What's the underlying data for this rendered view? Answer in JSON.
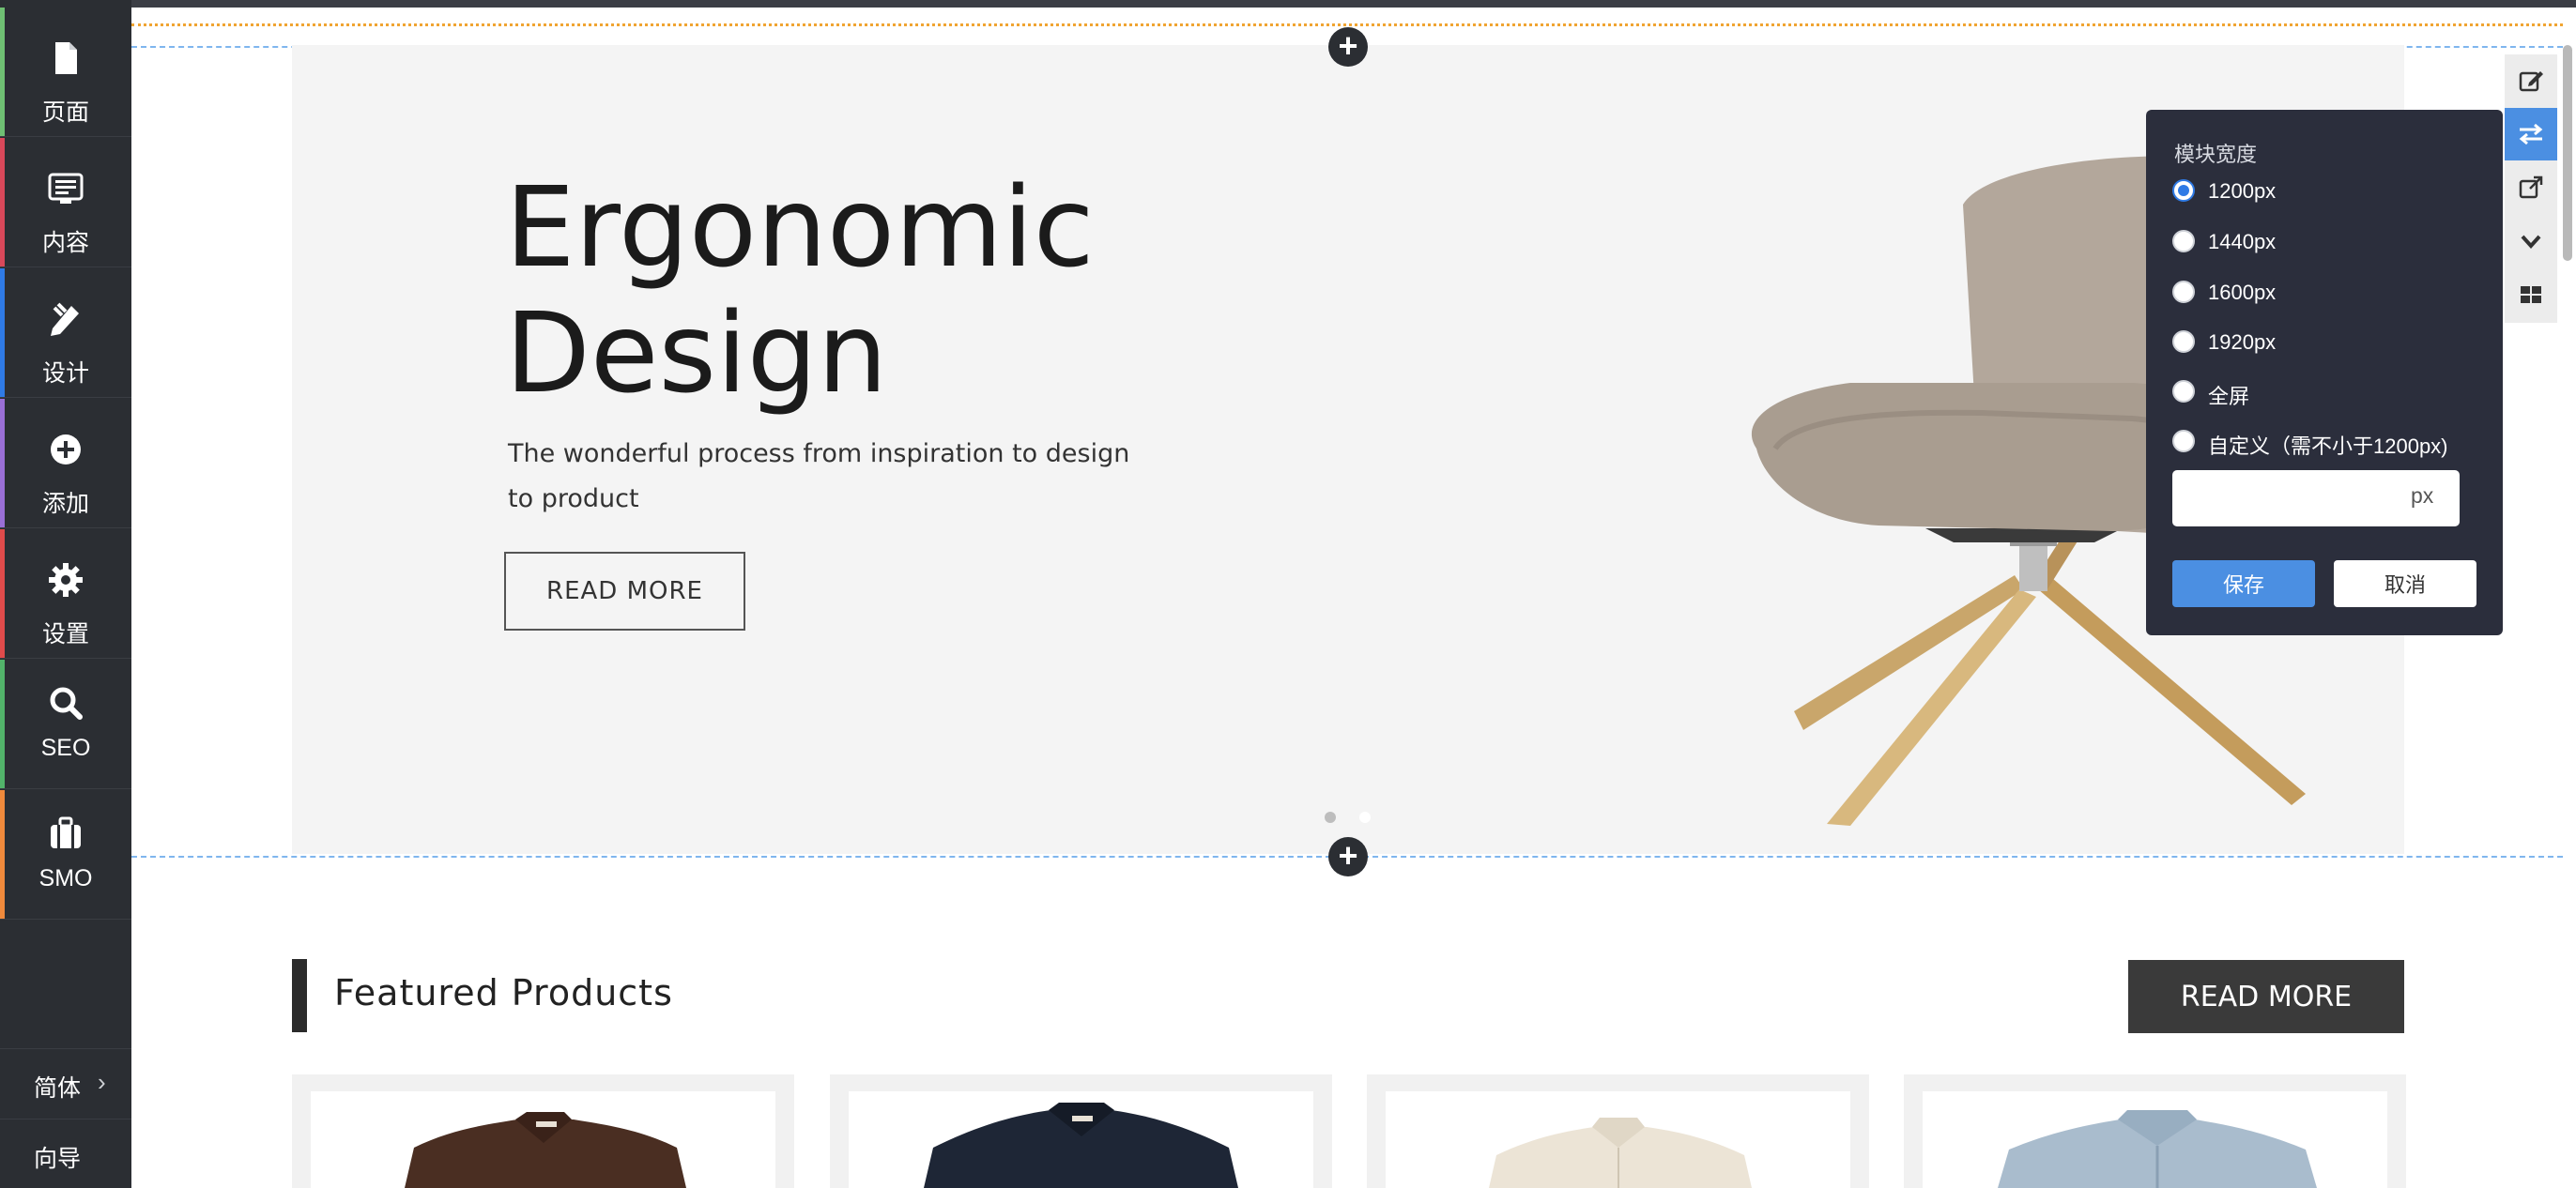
{
  "sidebar": {
    "items": [
      {
        "label": "页面",
        "icon": "page-icon",
        "stripe": "#6fbf73"
      },
      {
        "label": "内容",
        "icon": "content-icon",
        "stripe": "#d9485a"
      },
      {
        "label": "设计",
        "icon": "design-icon",
        "stripe": "#2f7ae5"
      },
      {
        "label": "添加",
        "icon": "add-icon",
        "stripe": "#9a6fd6"
      },
      {
        "label": "设置",
        "icon": "gear-icon",
        "stripe": "#e04b4b"
      },
      {
        "label": "SEO",
        "icon": "search-icon",
        "stripe": "#52b36a"
      },
      {
        "label": "SMO",
        "icon": "briefcase-icon",
        "stripe": "#f08a3c"
      }
    ],
    "language": "简体",
    "guide": "向导"
  },
  "hero": {
    "title_line1": "Ergonomic",
    "title_line2": "Design",
    "subtitle": "The wonderful process from inspiration to design to product",
    "button": "READ MORE"
  },
  "width_popup": {
    "title": "模块宽度",
    "options": [
      "1200px",
      "1440px",
      "1600px",
      "1920px",
      "全屏",
      "自定义（需不小于1200px)"
    ],
    "selected": "1200px",
    "custom_value": "",
    "unit": "px",
    "save": "保存",
    "cancel": "取消"
  },
  "featured": {
    "title": "Featured Products",
    "button": "READ MORE"
  },
  "colors": {
    "sidebar_bg": "#2b2e33",
    "accent": "#4b8fe2",
    "popup_bg": "#2b2e3c"
  }
}
